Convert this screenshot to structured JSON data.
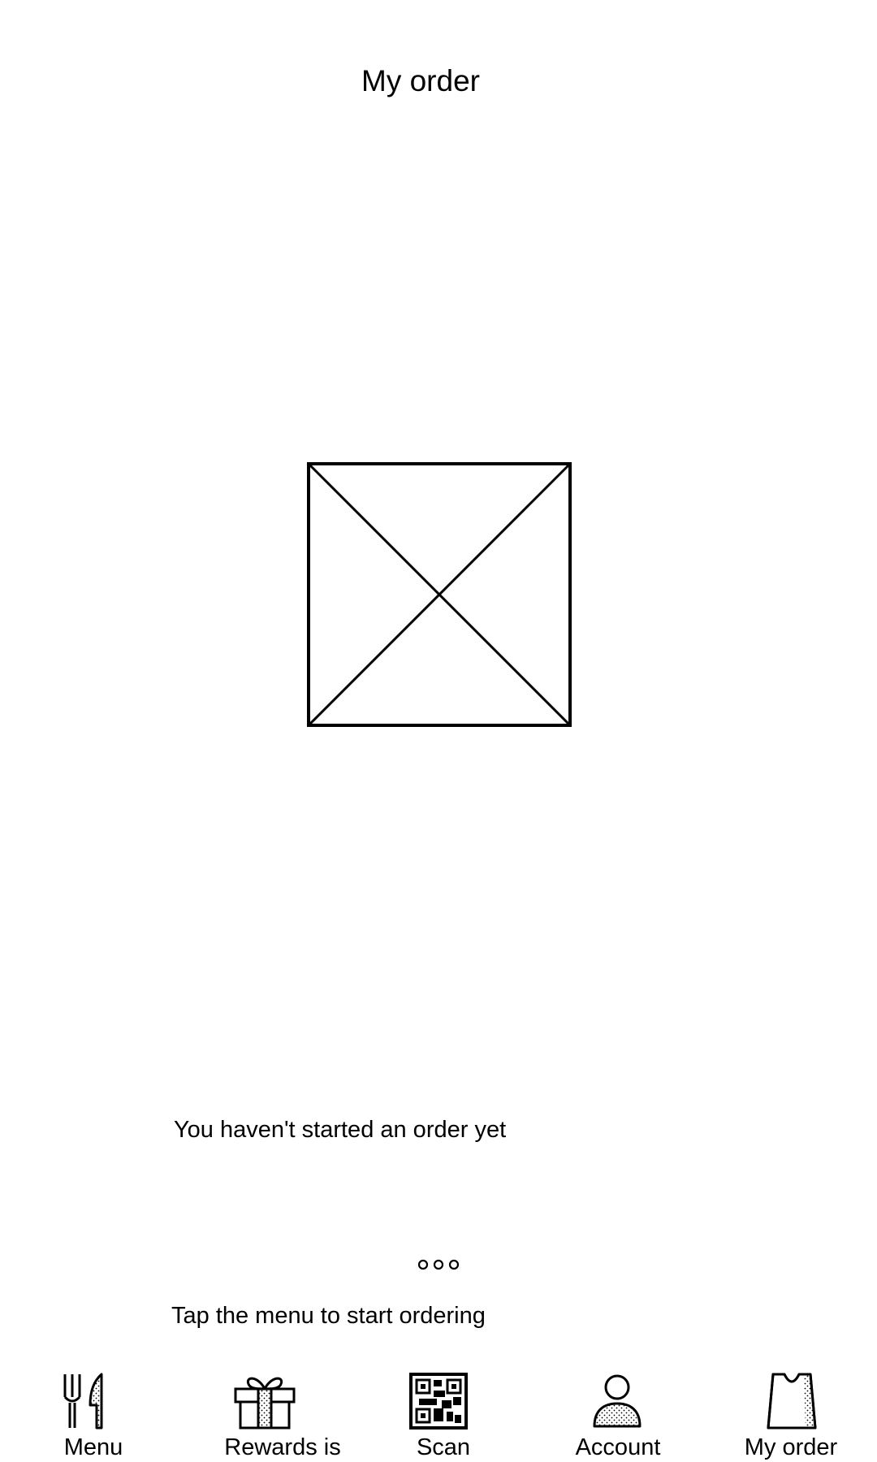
{
  "header": {
    "title": "My order"
  },
  "main": {
    "image_icon": "broken-image-placeholder-icon",
    "empty_message": "You haven't started an order yet",
    "loading_icon": "loading-dots-icon",
    "hint_message": "Tap the menu to start ordering"
  },
  "bottom_nav": {
    "items": [
      {
        "label": "Menu",
        "icon": "fork-knife-icon"
      },
      {
        "label": "Rewards is",
        "icon": "gift-icon"
      },
      {
        "label": "Scan",
        "icon": "qr-code-icon"
      },
      {
        "label": "Account",
        "icon": "person-icon"
      },
      {
        "label": "My order",
        "icon": "shopping-bag-icon"
      }
    ]
  }
}
